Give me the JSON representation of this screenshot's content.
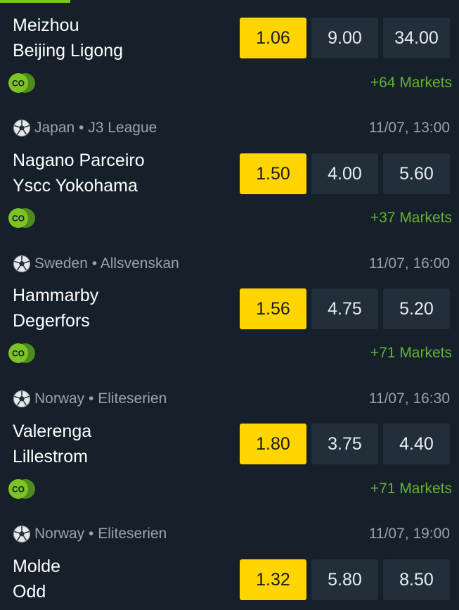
{
  "matches": [
    {
      "league": "",
      "time": "",
      "home": "Meizhou",
      "away": "Beijing Ligong",
      "odds": [
        "1.06",
        "9.00",
        "34.00"
      ],
      "markets": "+64 Markets"
    },
    {
      "league": "Japan • J3 League",
      "time": "11/07, 13:00",
      "home": "Nagano Parceiro",
      "away": "Yscc Yokohama",
      "odds": [
        "1.50",
        "4.00",
        "5.60"
      ],
      "markets": "+37 Markets"
    },
    {
      "league": "Sweden • Allsvenskan",
      "time": "11/07, 16:00",
      "home": "Hammarby",
      "away": "Degerfors",
      "odds": [
        "1.56",
        "4.75",
        "5.20"
      ],
      "markets": "+71 Markets"
    },
    {
      "league": "Norway • Eliteserien",
      "time": "11/07, 16:30",
      "home": "Valerenga",
      "away": "Lillestrom",
      "odds": [
        "1.80",
        "3.75",
        "4.40"
      ],
      "markets": "+71 Markets"
    },
    {
      "league": "Norway • Eliteserien",
      "time": "11/07, 19:00",
      "home": "Molde",
      "away": "Odd",
      "odds": [
        "1.32",
        "5.80",
        "8.50"
      ],
      "markets": ""
    }
  ],
  "colors": {
    "background": "#16202b",
    "odd_button": "#222e3a",
    "best_odd": "#ffd500",
    "markets_text": "#63b32e",
    "co_badge": "#7cc324"
  },
  "icons": {
    "sport": "soccer-ball-icon",
    "badge": "cash-out-icon"
  },
  "badge_text": "CO"
}
